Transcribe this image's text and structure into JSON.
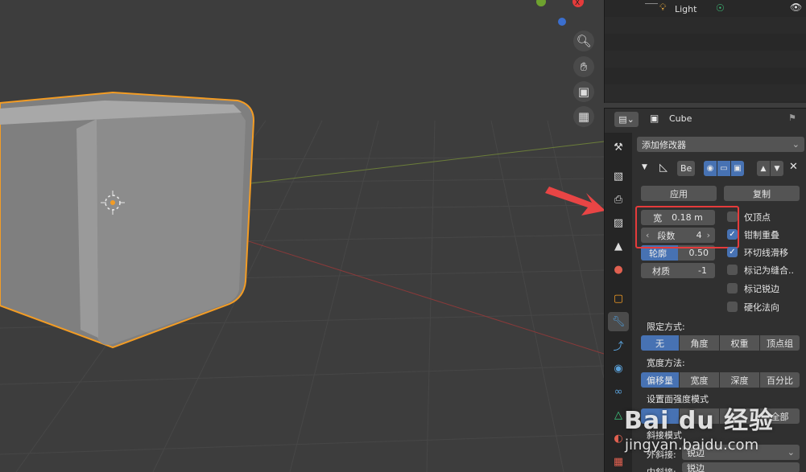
{
  "viewport": {
    "nav_icons": [
      "zoom-icon",
      "hand-pan-icon",
      "camera-icon",
      "grid-view-icon"
    ],
    "axis_colors": {
      "x": "#e53b3b",
      "y": "#6ea22f",
      "z": "#3b6fcf"
    },
    "selection_color": "#f39c24"
  },
  "outliner": {
    "light_label": "Light"
  },
  "properties": {
    "object_name": "Cube",
    "add_modifier_label": "添加修改器",
    "modifier_name": "Be",
    "apply_label": "应用",
    "copy_label": "复制",
    "width_label": "宽",
    "width_value": "0.18 m",
    "segments_label": "段数",
    "segments_value": "4",
    "profile_label": "轮廓",
    "profile_value": "0.50",
    "material_label": "材质",
    "material_value": "-1",
    "checkboxes": [
      {
        "label": "仅顶点",
        "checked": false
      },
      {
        "label": "钳制重叠",
        "checked": true
      },
      {
        "label": "环切线滑移",
        "checked": true
      },
      {
        "label": "标记为缝合..",
        "checked": false
      },
      {
        "label": "标记锐边",
        "checked": false
      },
      {
        "label": "硬化法向",
        "checked": false
      }
    ],
    "limit_method_label": "限定方式:",
    "limit_methods": [
      "无",
      "角度",
      "权重",
      "顶点组"
    ],
    "width_method_label": "宽度方法:",
    "width_methods": [
      "偏移量",
      "宽度",
      "深度",
      "百分比"
    ],
    "face_strength_label": "设置面强度模式",
    "face_strength_all": "全部",
    "miter_label": "斜接模式",
    "outer_miter_label": "外斜接:",
    "outer_miter_value": "锐边",
    "inner_miter_label": "内斜接:",
    "inner_miter_value": "锐边"
  },
  "watermark": {
    "brand": "Bai du 经验",
    "url": "jingyan.baidu.com"
  }
}
